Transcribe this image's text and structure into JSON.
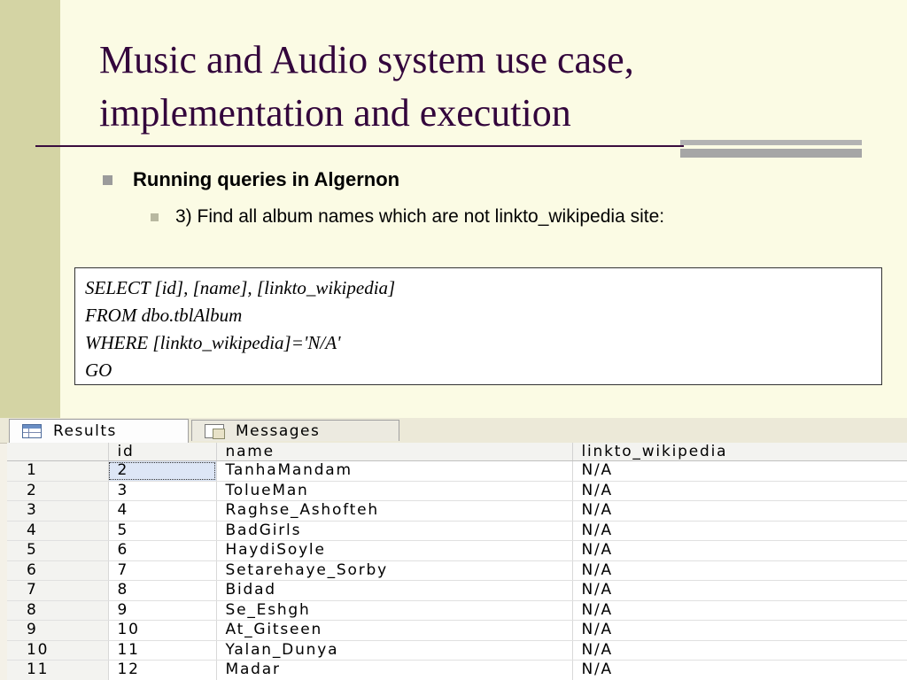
{
  "slide": {
    "title_line1": "Music and Audio system use case,",
    "title_line2": "implementation and execution",
    "bullet1": "Running queries in Algernon",
    "bullet2": "3) Find all album names which are not linkto_wikipedia site:",
    "query": [
      "SELECT [id], [name], [linkto_wikipedia]",
      "FROM dbo.tblAlbum",
      "WHERE [linkto_wikipedia]='N/A'",
      "GO"
    ]
  },
  "colors": {
    "title": "#33063c",
    "left_strip": "#d4d4a4",
    "background": "#fbfbe4"
  },
  "results_panel": {
    "tabs": [
      {
        "label": "Results",
        "icon": "grid-icon",
        "active": true
      },
      {
        "label": "Messages",
        "icon": "messages-icon",
        "active": false
      }
    ],
    "columns": [
      "",
      "id",
      "name",
      "linkto_wikipedia"
    ],
    "rows": [
      [
        "1",
        "2",
        "TanhaMandam",
        "N/A"
      ],
      [
        "2",
        "3",
        "ToluеMan",
        "N/A"
      ],
      [
        "3",
        "4",
        "Raghse_Ashofteh",
        "N/A"
      ],
      [
        "4",
        "5",
        "BadGirls",
        "N/A"
      ],
      [
        "5",
        "6",
        "HaydiSoyle",
        "N/A"
      ],
      [
        "6",
        "7",
        "Setarehaye_Sorby",
        "N/A"
      ],
      [
        "7",
        "8",
        "Bidad",
        "N/A"
      ],
      [
        "8",
        "9",
        "Se_Eshgh",
        "N/A"
      ],
      [
        "9",
        "10",
        "At_Gitseen",
        "N/A"
      ],
      [
        "10",
        "11",
        "Yalan_Dunya",
        "N/A"
      ],
      [
        "11",
        "12",
        "Madar",
        "N/A"
      ]
    ]
  }
}
